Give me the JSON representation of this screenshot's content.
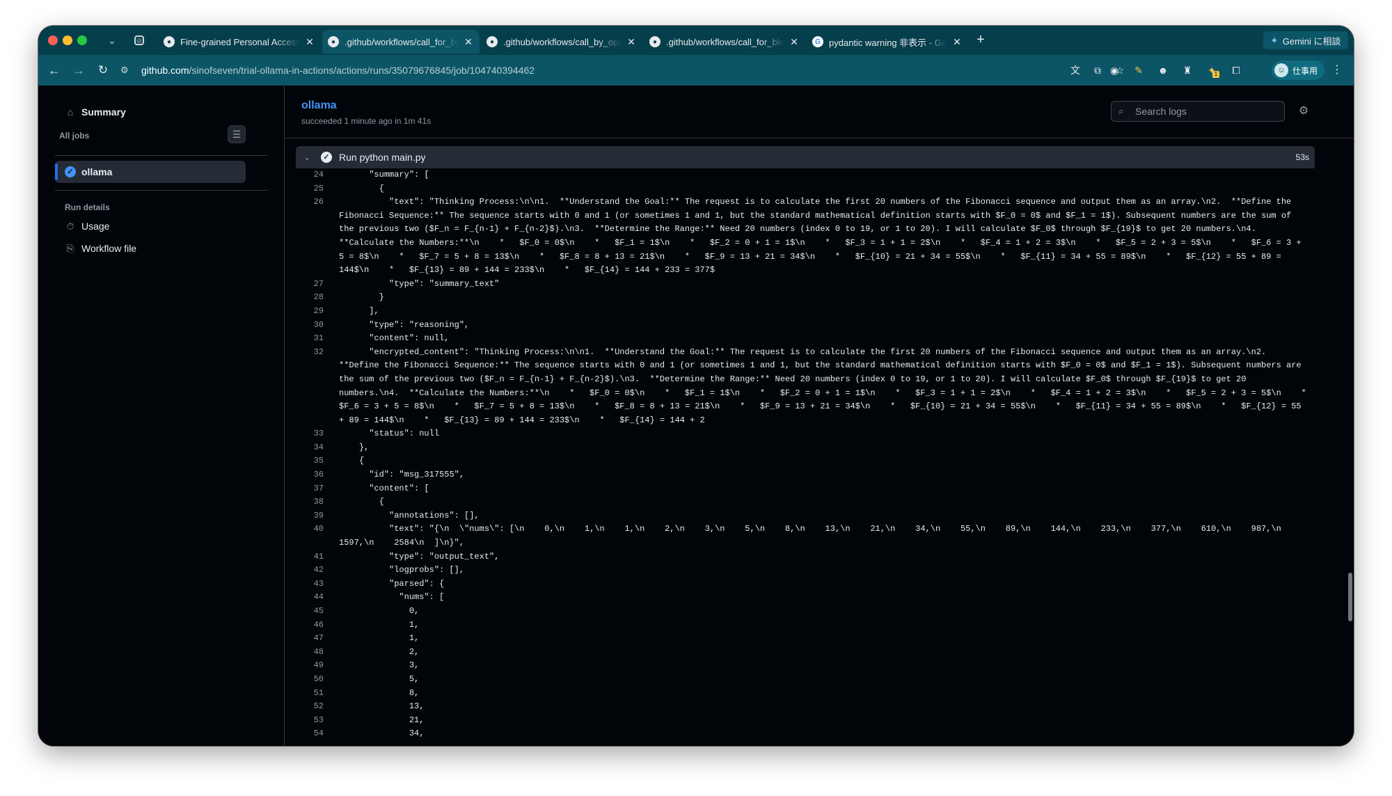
{
  "browser": {
    "tabs": [
      {
        "title": "Fine-grained Personal Access Tokens",
        "favicon": "github-icon",
        "active": false
      },
      {
        "title": ".github/workflows/call_for_blog.yml",
        "favicon": "github-icon",
        "active": true
      },
      {
        "title": ".github/workflows/call_by_openai.yml",
        "favicon": "github-icon",
        "active": false
      },
      {
        "title": ".github/workflows/call_for_blog.yml",
        "favicon": "github-icon",
        "active": false
      },
      {
        "title": "pydantic warning 非表示 - Google",
        "favicon": "google-icon",
        "active": false
      }
    ],
    "gemini_label": "Gemini に相談",
    "url_host": "github.com",
    "url_path": "/sinofseven/trial-ollama-in-actions/actions/runs/35079676845/job/104740394462",
    "profile_label": "仕事用",
    "extension_badge": "1"
  },
  "sidebar": {
    "summary_label": "Summary",
    "all_jobs_label": "All jobs",
    "jobs": [
      {
        "name": "ollama",
        "status": "success"
      }
    ],
    "run_details_label": "Run details",
    "usage_label": "Usage",
    "workflow_file_label": "Workflow file"
  },
  "job": {
    "title": "ollama",
    "status_text": "succeeded 1 minute ago in 1m 41s",
    "search_placeholder": "Search logs",
    "step_name": "Run python main.py",
    "step_duration": "53s"
  },
  "colors": {
    "chrome_tabstrip": "#063f4c",
    "chrome_toolbar": "#0b5566",
    "page_bg": "#010409",
    "link_blue": "#4493f8"
  },
  "log_lines": [
    {
      "n": "24",
      "t": "      \"summary\": ["
    },
    {
      "n": "25",
      "t": "        {"
    },
    {
      "n": "26",
      "t": "          \"text\": \"Thinking Process:\\n\\n1.  **Understand the Goal:** The request is to calculate the first 20 numbers of the Fibonacci sequence and output them as an array.\\n2.  **Define the Fibonacci Sequence:** The sequence starts with 0 and 1 (or sometimes 1 and 1, but the standard mathematical definition starts with $F_0 = 0$ and $F_1 = 1$). Subsequent numbers are the sum of the previous two ($F_n = F_{n-1} + F_{n-2}$).\\n3.  **Determine the Range:** Need 20 numbers (index 0 to 19, or 1 to 20). I will calculate $F_0$ through $F_{19}$ to get 20 numbers.\\n4.  **Calculate the Numbers:**\\n    *   $F_0 = 0$\\n    *   $F_1 = 1$\\n    *   $F_2 = 0 + 1 = 1$\\n    *   $F_3 = 1 + 1 = 2$\\n    *   $F_4 = 1 + 2 = 3$\\n    *   $F_5 = 2 + 3 = 5$\\n    *   $F_6 = 3 + 5 = 8$\\n    *   $F_7 = 5 + 8 = 13$\\n    *   $F_8 = 8 + 13 = 21$\\n    *   $F_9 = 13 + 21 = 34$\\n    *   $F_{10} = 21 + 34 = 55$\\n    *   $F_{11} = 34 + 55 = 89$\\n    *   $F_{12} = 55 + 89 = 144$\\n    *   $F_{13} = 89 + 144 = 233$\\n    *   $F_{14} = 144 + 233 = 377$"
    },
    {
      "n": "27",
      "t": "          \"type\": \"summary_text\""
    },
    {
      "n": "28",
      "t": "        }"
    },
    {
      "n": "29",
      "t": "      ],"
    },
    {
      "n": "30",
      "t": "      \"type\": \"reasoning\","
    },
    {
      "n": "31",
      "t": "      \"content\": null,"
    },
    {
      "n": "32",
      "t": "      \"encrypted_content\": \"Thinking Process:\\n\\n1.  **Understand the Goal:** The request is to calculate the first 20 numbers of the Fibonacci sequence and output them as an array.\\n2.  **Define the Fibonacci Sequence:** The sequence starts with 0 and 1 (or sometimes 1 and 1, but the standard mathematical definition starts with $F_0 = 0$ and $F_1 = 1$). Subsequent numbers are the sum of the previous two ($F_n = F_{n-1} + F_{n-2}$).\\n3.  **Determine the Range:** Need 20 numbers (index 0 to 19, or 1 to 20). I will calculate $F_0$ through $F_{19}$ to get 20 numbers.\\n4.  **Calculate the Numbers:**\\n    *   $F_0 = 0$\\n    *   $F_1 = 1$\\n    *   $F_2 = 0 + 1 = 1$\\n    *   $F_3 = 1 + 1 = 2$\\n    *   $F_4 = 1 + 2 = 3$\\n    *   $F_5 = 2 + 3 = 5$\\n    *   $F_6 = 3 + 5 = 8$\\n    *   $F_7 = 5 + 8 = 13$\\n    *   $F_8 = 8 + 13 = 21$\\n    *   $F_9 = 13 + 21 = 34$\\n    *   $F_{10} = 21 + 34 = 55$\\n    *   $F_{11} = 34 + 55 = 89$\\n    *   $F_{12} = 55 + 89 = 144$\\n    *   $F_{13} = 89 + 144 = 233$\\n    *   $F_{14} = 144 + 2"
    },
    {
      "n": "33",
      "t": "      \"status\": null"
    },
    {
      "n": "34",
      "t": "    },"
    },
    {
      "n": "35",
      "t": "    {"
    },
    {
      "n": "36",
      "t": "      \"id\": \"msg_317555\","
    },
    {
      "n": "37",
      "t": "      \"content\": ["
    },
    {
      "n": "38",
      "t": "        {"
    },
    {
      "n": "39",
      "t": "          \"annotations\": [],"
    },
    {
      "n": "40",
      "t": "          \"text\": \"{\\n  \\\"nums\\\": [\\n    0,\\n    1,\\n    1,\\n    2,\\n    3,\\n    5,\\n    8,\\n    13,\\n    21,\\n    34,\\n    55,\\n    89,\\n    144,\\n    233,\\n    377,\\n    610,\\n    987,\\n    1597,\\n    2584\\n  ]\\n}\","
    },
    {
      "n": "41",
      "t": "          \"type\": \"output_text\","
    },
    {
      "n": "42",
      "t": "          \"logprobs\": [],"
    },
    {
      "n": "43",
      "t": "          \"parsed\": {"
    },
    {
      "n": "44",
      "t": "            \"nums\": ["
    },
    {
      "n": "45",
      "t": "              0,"
    },
    {
      "n": "46",
      "t": "              1,"
    },
    {
      "n": "47",
      "t": "              1,"
    },
    {
      "n": "48",
      "t": "              2,"
    },
    {
      "n": "49",
      "t": "              3,"
    },
    {
      "n": "50",
      "t": "              5,"
    },
    {
      "n": "51",
      "t": "              8,"
    },
    {
      "n": "52",
      "t": "              13,"
    },
    {
      "n": "53",
      "t": "              21,"
    },
    {
      "n": "54",
      "t": "              34,"
    }
  ]
}
